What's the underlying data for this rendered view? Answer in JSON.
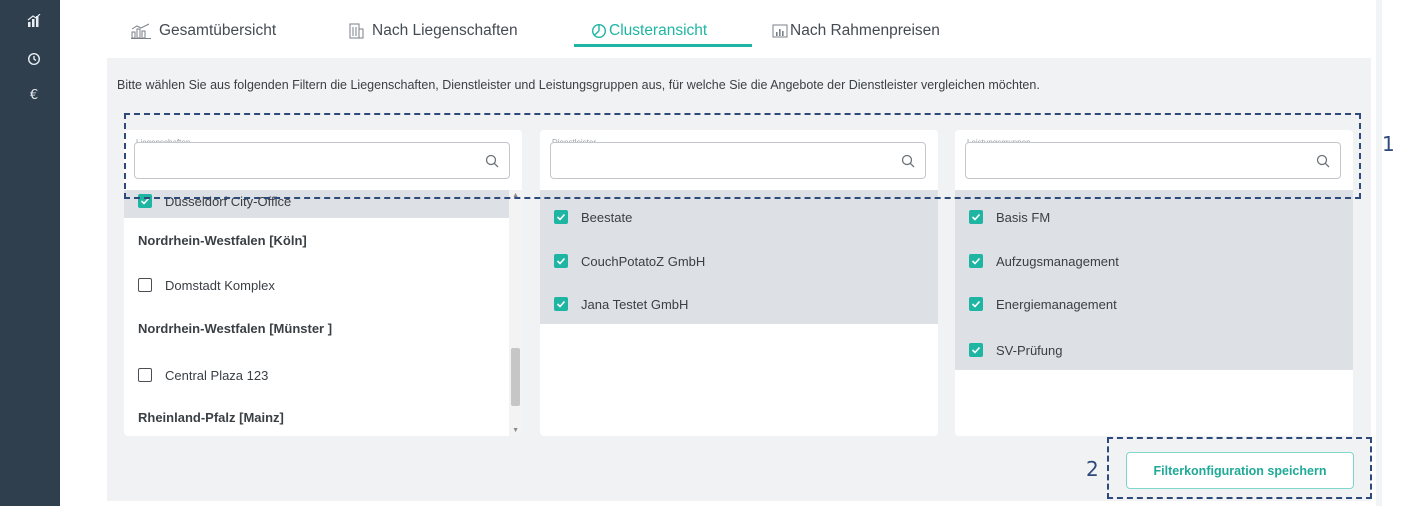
{
  "sidebar": {
    "icons": [
      {
        "name": "chart-icon",
        "glyph": "📈"
      },
      {
        "name": "clock-icon",
        "glyph": "⏱"
      },
      {
        "name": "euro-icon",
        "glyph": "€"
      }
    ]
  },
  "tabs": [
    {
      "label": "Gesamtübersicht",
      "icon": "building-chart-icon"
    },
    {
      "label": "Nach Liegenschaften",
      "icon": "building-icon"
    },
    {
      "label": "Clusteransicht",
      "icon": "pie-chart-icon",
      "active": true
    },
    {
      "label": "Nach Rahmenpreisen",
      "icon": "bar-chart-icon"
    }
  ],
  "intro_text": "Bitte wählen Sie aus folgenden Filtern die Liegenschaften, Dienstleister und Leistungsgruppen aus, für welche Sie die Angebote der Dienstleister vergleichen möchten.",
  "filters": {
    "liegenschaften": {
      "label": "Liegenschaften",
      "value": "",
      "rows": [
        {
          "type": "item",
          "label": "Düsseldorf City-Office",
          "checked": true
        },
        {
          "type": "group",
          "label": "Nordrhein-Westfalen [Köln]"
        },
        {
          "type": "item",
          "label": "Domstadt Komplex",
          "checked": false
        },
        {
          "type": "group",
          "label": "Nordrhein-Westfalen [Münster ]"
        },
        {
          "type": "item",
          "label": "Central Plaza 123",
          "checked": false
        },
        {
          "type": "group",
          "label": "Rheinland-Pfalz [Mainz]"
        }
      ]
    },
    "dienstleister": {
      "label": "Dienstleister",
      "value": "",
      "rows": [
        {
          "type": "item",
          "label": "Beestate",
          "checked": true
        },
        {
          "type": "item",
          "label": "CouchPotatoZ GmbH",
          "checked": true
        },
        {
          "type": "item",
          "label": "Jana Testet GmbH",
          "checked": true
        }
      ]
    },
    "leistungsgruppen": {
      "label": "Leistungsgruppen",
      "value": "",
      "rows": [
        {
          "type": "item",
          "label": "Basis FM",
          "checked": true
        },
        {
          "type": "item",
          "label": "Aufzugsmanagement",
          "checked": true
        },
        {
          "type": "item",
          "label": "Energiemanagement",
          "checked": true
        },
        {
          "type": "item",
          "label": "SV-Prüfung",
          "checked": true
        }
      ]
    }
  },
  "save_button": "Filterkonfiguration speichern",
  "annotations": {
    "filter_marker": "1",
    "button_marker": "2"
  },
  "colors": {
    "accent": "#1fb5a3",
    "sidebar": "#303f4e",
    "annotation": "#2d4a7a"
  }
}
